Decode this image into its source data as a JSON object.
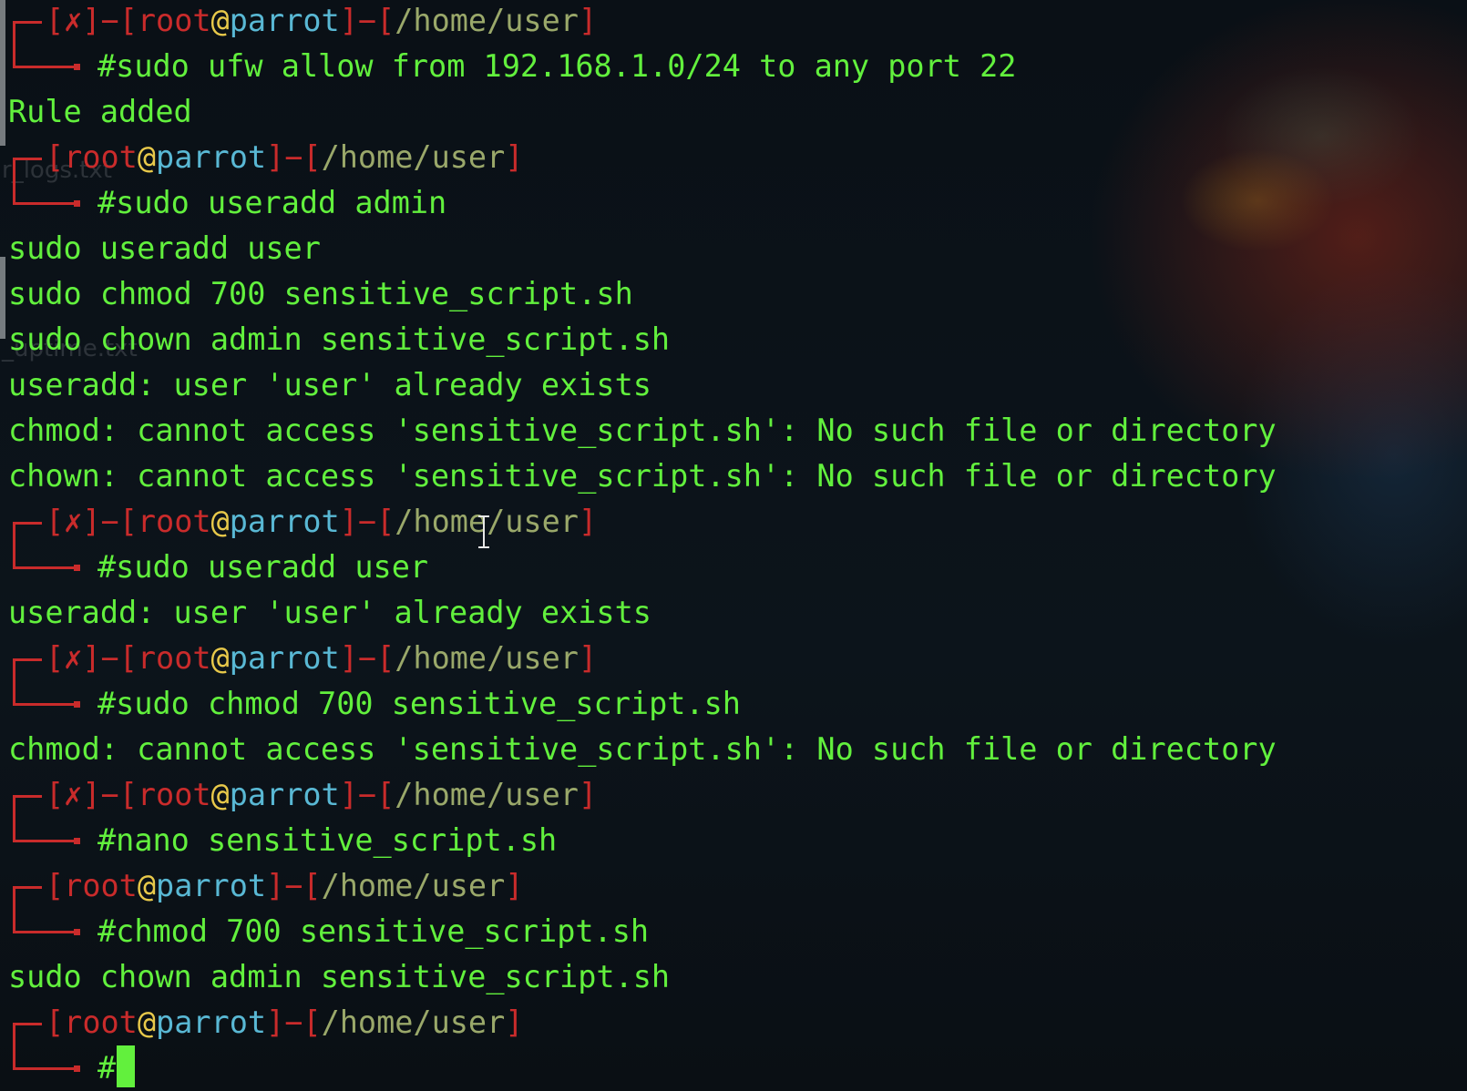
{
  "terminal": {
    "prompt": {
      "open_bracket": "[",
      "close_bracket": "]",
      "error_mark": "✗",
      "dash": "−",
      "user": "root",
      "at": "@",
      "host": "parrot",
      "path": "/home/user",
      "symbol": "#"
    },
    "background_ghost": [
      "r_logs.txt",
      "_uptime.txt"
    ],
    "blocks": [
      {
        "error": true,
        "command": "sudo ufw allow from 192.168.1.0/24 to any port 22",
        "output": [
          "Rule added"
        ]
      },
      {
        "error": false,
        "command": "sudo useradd admin",
        "output": [
          "sudo useradd user",
          "sudo chmod 700 sensitive_script.sh",
          "sudo chown admin sensitive_script.sh",
          "useradd: user 'user' already exists",
          "chmod: cannot access 'sensitive_script.sh': No such file or directory",
          "chown: cannot access 'sensitive_script.sh': No such file or directory"
        ]
      },
      {
        "error": true,
        "command": "sudo useradd user",
        "output": [
          "useradd: user 'user' already exists"
        ]
      },
      {
        "error": true,
        "command": "sudo chmod 700 sensitive_script.sh",
        "output": [
          "chmod: cannot access 'sensitive_script.sh': No such file or directory"
        ]
      },
      {
        "error": true,
        "command": "nano sensitive_script.sh",
        "output": []
      },
      {
        "error": false,
        "command": "chmod 700 sensitive_script.sh",
        "output": [
          "sudo chown admin sensitive_script.sh"
        ]
      },
      {
        "error": false,
        "command": "",
        "output": [],
        "active": true
      }
    ],
    "colors": {
      "output": "#62f03d",
      "bracket": "#c92b2b",
      "at": "#e8c94a",
      "host": "#59b8d4",
      "path": "#9aa86a"
    }
  }
}
